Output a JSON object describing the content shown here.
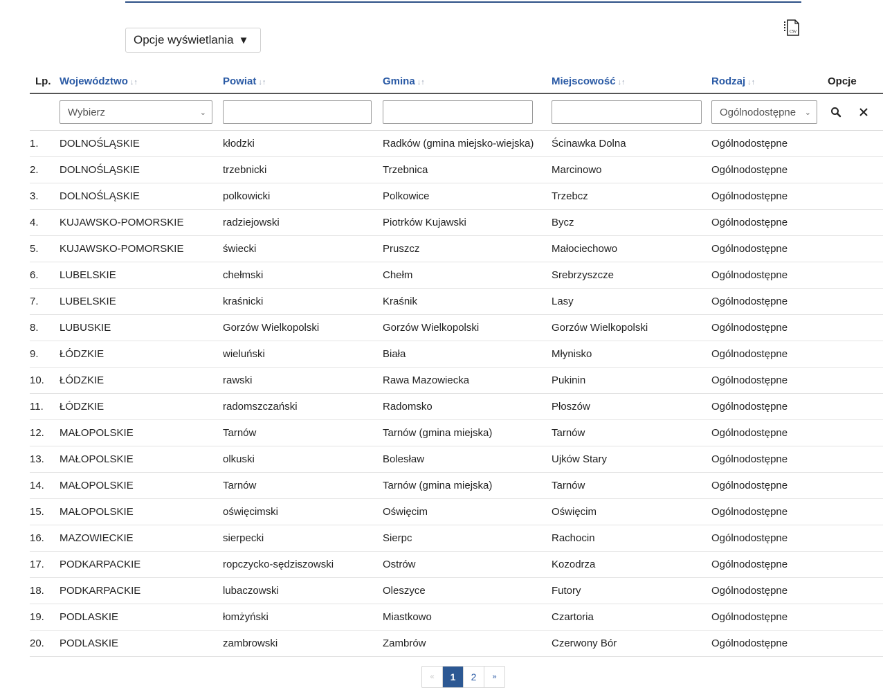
{
  "toolbar": {
    "options_label": "Opcje wyświetlania",
    "options_caret": "▼",
    "export_icon": "csv-export-icon"
  },
  "table": {
    "columns": {
      "lp": "Lp.",
      "wojewodztwo": "Województwo",
      "powiat": "Powiat",
      "gmina": "Gmina",
      "miejscowosc": "Miejscowość",
      "rodzaj": "Rodzaj",
      "opcje": "Opcje"
    },
    "sort_glyph": "↓↑",
    "filters": {
      "wojewodztwo_selected": "Wybierz",
      "powiat_value": "",
      "gmina_value": "",
      "miejscowosc_value": "",
      "rodzaj_selected": "Ogólnodostępne"
    },
    "rows": [
      {
        "lp": "1.",
        "woj": "DOLNOŚLĄSKIE",
        "powiat": "kłodzki",
        "gmina": "Radków (gmina miejsko-wiejska)",
        "miejsc": "Ścinawka Dolna",
        "rodzaj": "Ogólnodostępne"
      },
      {
        "lp": "2.",
        "woj": "DOLNOŚLĄSKIE",
        "powiat": "trzebnicki",
        "gmina": "Trzebnica",
        "miejsc": "Marcinowo",
        "rodzaj": "Ogólnodostępne"
      },
      {
        "lp": "3.",
        "woj": "DOLNOŚLĄSKIE",
        "powiat": "polkowicki",
        "gmina": "Polkowice",
        "miejsc": "Trzebcz",
        "rodzaj": "Ogólnodostępne"
      },
      {
        "lp": "4.",
        "woj": "KUJAWSKO-POMORSKIE",
        "powiat": "radziejowski",
        "gmina": "Piotrków Kujawski",
        "miejsc": "Bycz",
        "rodzaj": "Ogólnodostępne"
      },
      {
        "lp": "5.",
        "woj": "KUJAWSKO-POMORSKIE",
        "powiat": "świecki",
        "gmina": "Pruszcz",
        "miejsc": "Małociechowo",
        "rodzaj": "Ogólnodostępne"
      },
      {
        "lp": "6.",
        "woj": "LUBELSKIE",
        "powiat": "chełmski",
        "gmina": "Chełm",
        "miejsc": "Srebrzyszcze",
        "rodzaj": "Ogólnodostępne"
      },
      {
        "lp": "7.",
        "woj": "LUBELSKIE",
        "powiat": "kraśnicki",
        "gmina": "Kraśnik",
        "miejsc": "Lasy",
        "rodzaj": "Ogólnodostępne"
      },
      {
        "lp": "8.",
        "woj": "LUBUSKIE",
        "powiat": "Gorzów Wielkopolski",
        "gmina": "Gorzów Wielkopolski",
        "miejsc": "Gorzów Wielkopolski",
        "rodzaj": "Ogólnodostępne"
      },
      {
        "lp": "9.",
        "woj": "ŁÓDZKIE",
        "powiat": "wieluński",
        "gmina": "Biała",
        "miejsc": "Młynisko",
        "rodzaj": "Ogólnodostępne"
      },
      {
        "lp": "10.",
        "woj": "ŁÓDZKIE",
        "powiat": "rawski",
        "gmina": "Rawa Mazowiecka",
        "miejsc": "Pukinin",
        "rodzaj": "Ogólnodostępne"
      },
      {
        "lp": "11.",
        "woj": "ŁÓDZKIE",
        "powiat": "radomszczański",
        "gmina": "Radomsko",
        "miejsc": "Płoszów",
        "rodzaj": "Ogólnodostępne"
      },
      {
        "lp": "12.",
        "woj": "MAŁOPOLSKIE",
        "powiat": "Tarnów",
        "gmina": "Tarnów (gmina miejska)",
        "miejsc": "Tarnów",
        "rodzaj": "Ogólnodostępne"
      },
      {
        "lp": "13.",
        "woj": "MAŁOPOLSKIE",
        "powiat": "olkuski",
        "gmina": "Bolesław",
        "miejsc": "Ujków Stary",
        "rodzaj": "Ogólnodostępne"
      },
      {
        "lp": "14.",
        "woj": "MAŁOPOLSKIE",
        "powiat": "Tarnów",
        "gmina": "Tarnów (gmina miejska)",
        "miejsc": "Tarnów",
        "rodzaj": "Ogólnodostępne"
      },
      {
        "lp": "15.",
        "woj": "MAŁOPOLSKIE",
        "powiat": "oświęcimski",
        "gmina": "Oświęcim",
        "miejsc": "Oświęcim",
        "rodzaj": "Ogólnodostępne"
      },
      {
        "lp": "16.",
        "woj": "MAZOWIECKIE",
        "powiat": "sierpecki",
        "gmina": "Sierpc",
        "miejsc": "Rachocin",
        "rodzaj": "Ogólnodostępne"
      },
      {
        "lp": "17.",
        "woj": "PODKARPACKIE",
        "powiat": "ropczycko-sędziszowski",
        "gmina": "Ostrów",
        "miejsc": "Kozodrza",
        "rodzaj": "Ogólnodostępne"
      },
      {
        "lp": "18.",
        "woj": "PODKARPACKIE",
        "powiat": "lubaczowski",
        "gmina": "Oleszyce",
        "miejsc": "Futory",
        "rodzaj": "Ogólnodostępne"
      },
      {
        "lp": "19.",
        "woj": "PODLASKIE",
        "powiat": "łomżyński",
        "gmina": "Miastkowo",
        "miejsc": "Czartoria",
        "rodzaj": "Ogólnodostępne"
      },
      {
        "lp": "20.",
        "woj": "PODLASKIE",
        "powiat": "zambrowski",
        "gmina": "Zambrów",
        "miejsc": "Czerwony Bór",
        "rodzaj": "Ogólnodostępne"
      }
    ]
  },
  "pagination": {
    "prev": "«",
    "pages": [
      "1",
      "2"
    ],
    "current": "1",
    "next": "»"
  },
  "colors": {
    "accent": "#2c5893",
    "link": "#2a5aa5",
    "top_rule": "#2c4f86"
  }
}
